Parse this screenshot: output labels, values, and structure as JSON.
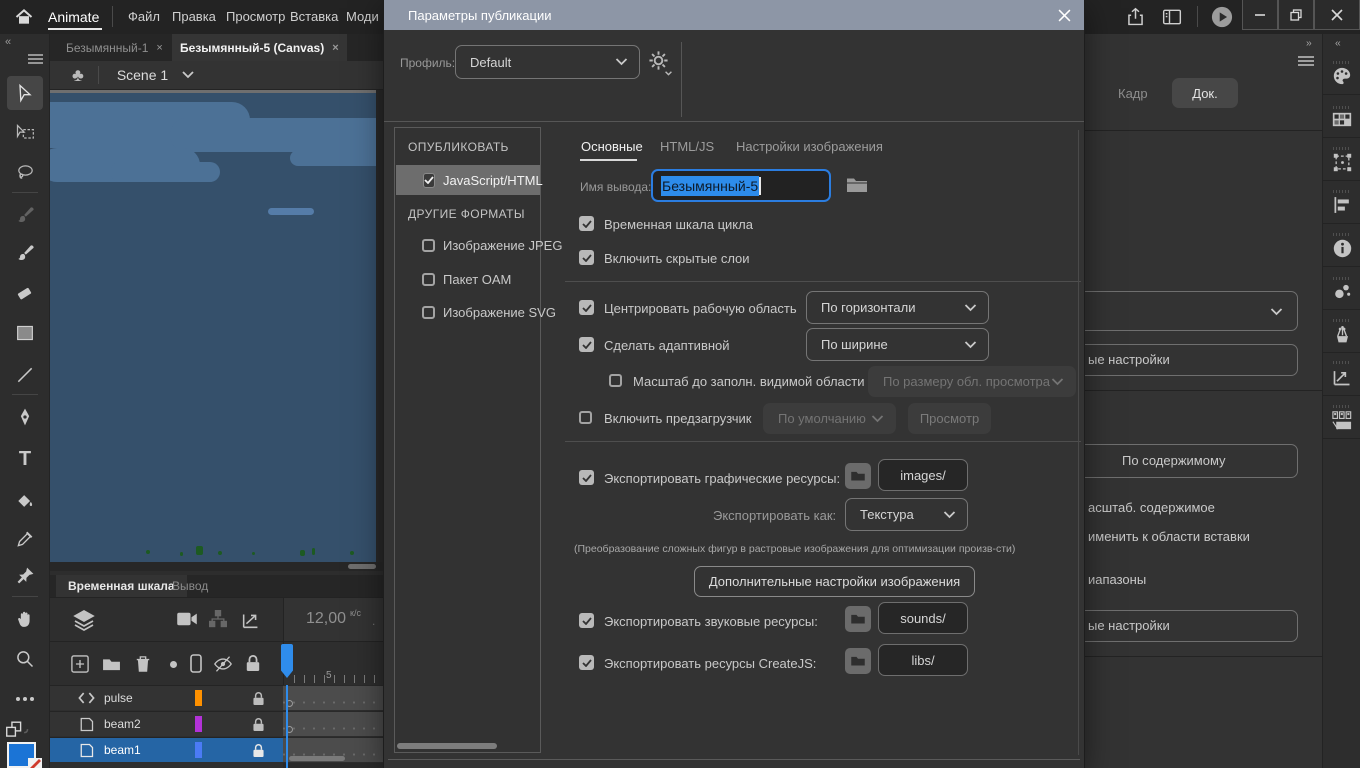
{
  "colors": {
    "accent_blue": "#2b7de0",
    "selection_blue": "#2d8ceb",
    "titlebar": "#8d96a6",
    "stage_sky": "#35506b",
    "stage_cloud": "#4c7196",
    "layer_selected_row": "#2565a5",
    "swatch_pulse": "#ff9100",
    "swatch_beam2": "#b332d8",
    "swatch_beam1": "#4b7bf5",
    "fill_swatch": "#1b74d6"
  },
  "menubar": {
    "app": "Animate",
    "items": [
      "Файл",
      "Правка",
      "Просмотр",
      "Вставка",
      "Моди"
    ]
  },
  "doc_tabs": {
    "tab1": "Безымянный-1",
    "tab2": "Безымянный-5 (Canvas)",
    "close": "×"
  },
  "scene": {
    "name": "Scene 1"
  },
  "dialog": {
    "title": "Параметры публикации",
    "profile_label": "Профиль:",
    "profile_value": "Default",
    "list": {
      "publish_header": "ОПУБЛИКОВАТЬ",
      "publish_item": "JavaScript/HTML",
      "other_header": "ДРУГИЕ ФОРМАТЫ",
      "other_1": "Изображение JPEG",
      "other_2": "Пакет OAM",
      "other_3": "Изображение SVG"
    },
    "tabs": {
      "basic": "Основные",
      "htmljs": "HTML/JS",
      "image": "Настройки изображения"
    },
    "output": {
      "label": "Имя вывода:",
      "value": "Безымянный-5"
    },
    "options": {
      "loop": "Временная шкала цикла",
      "hidden_layers": "Включить скрытые слои",
      "center": "Центрировать рабочую область",
      "center_value": "По горизонтали",
      "responsive": "Сделать адаптивной",
      "responsive_value": "По ширине",
      "scale": "Масштаб до заполн. видимой области",
      "scale_value": "По размеру обл. просмотра",
      "preloader": "Включить предзагрузчик",
      "preloader_value": "По умолчанию",
      "preloader_preview": "Просмотр",
      "export_graphics": "Экспортировать графические ресурсы:",
      "graphics_path": "images/",
      "export_as": "Экспортировать как:",
      "export_as_value": "Текстура",
      "note": "(Преобразование сложных фигур в растровые изображения для оптимизации произв-сти)",
      "advanced_button": "Дополнительные настройки изображения",
      "export_sounds": "Экспортировать звуковые ресурсы:",
      "sounds_path": "sounds/",
      "export_createjs": "Экспортировать ресурсы CreateJS:",
      "createjs_path": "libs/"
    }
  },
  "timeline": {
    "tab_timeline": "Временная шкала",
    "tab_output": "Вывод",
    "fps_value": "12,00",
    "fps_unit": "к/с",
    "ruler_label": "5",
    "layers": [
      {
        "name": "pulse"
      },
      {
        "name": "beam2"
      },
      {
        "name": "beam1"
      }
    ]
  },
  "right_panel": {
    "tab_frame": "Кадр",
    "tab_doc": "Док.",
    "truncated_settings_top": "ые настройки",
    "fit_content_button": "По содержимому",
    "truncated_scale_content": "асштаб. содержимое",
    "truncated_apply_paste": "именить к области вставки",
    "truncated_ranges": "иапазоны",
    "truncated_settings_bottom": "ые настройки"
  }
}
